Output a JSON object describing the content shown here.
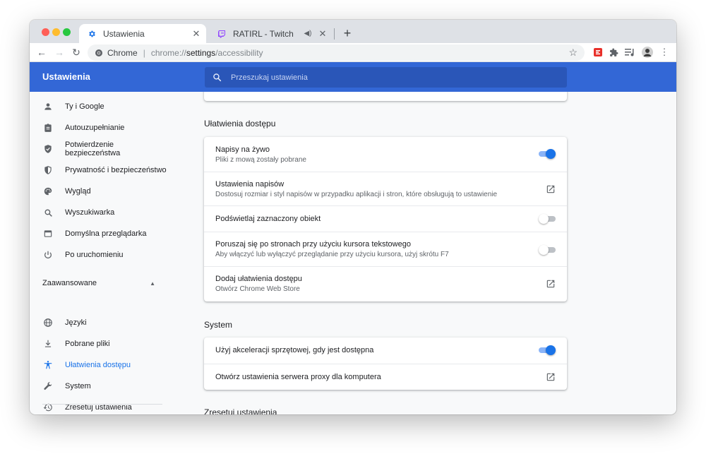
{
  "browser": {
    "tabs": [
      {
        "title": "Ustawienia",
        "icon": "gear-icon",
        "active": true
      },
      {
        "title": "RATIRL - Twitch",
        "icon": "twitch-icon",
        "active": false,
        "audio": true
      }
    ],
    "new_tab_label": "+",
    "omnibox": {
      "site_label": "Chrome",
      "divider": "|",
      "scheme": "chrome://",
      "host": "settings",
      "path": "/accessibility"
    }
  },
  "settings": {
    "title": "Ustawienia",
    "search_placeholder": "Przeszukaj ustawienia",
    "sidebar": {
      "items": [
        {
          "label": "Ty i Google",
          "icon": "person-icon"
        },
        {
          "label": "Autouzupełnianie",
          "icon": "clipboard-icon"
        },
        {
          "label": "Potwierdzenie bezpieczeństwa",
          "icon": "shield-check-icon"
        },
        {
          "label": "Prywatność i bezpieczeństwo",
          "icon": "shield-icon"
        },
        {
          "label": "Wygląd",
          "icon": "palette-icon"
        },
        {
          "label": "Wyszukiwarka",
          "icon": "search-icon"
        },
        {
          "label": "Domyślna przeglądarka",
          "icon": "browser-icon"
        },
        {
          "label": "Po uruchomieniu",
          "icon": "power-icon"
        }
      ],
      "advanced_label": "Zaawansowane",
      "advanced_items": [
        {
          "label": "Języki",
          "icon": "globe-icon"
        },
        {
          "label": "Pobrane pliki",
          "icon": "download-icon"
        },
        {
          "label": "Ułatwienia dostępu",
          "icon": "accessibility-icon",
          "selected": true
        },
        {
          "label": "System",
          "icon": "wrench-icon"
        },
        {
          "label": "Zresetuj ustawienia",
          "icon": "restore-icon"
        }
      ]
    },
    "accessibility": {
      "title": "Ułatwienia dostępu",
      "rows": [
        {
          "label": "Napisy na żywo",
          "sublabel": "Pliki z mową zostały pobrane",
          "control": "toggle",
          "on": true
        },
        {
          "label": "Ustawienia napisów",
          "sublabel": "Dostosuj rozmiar i styl napisów w przypadku aplikacji i stron, które obsługują to ustawienie",
          "control": "link"
        },
        {
          "label": "Podświetlaj zaznaczony obiekt",
          "control": "toggle",
          "on": false
        },
        {
          "label": "Poruszaj się po stronach przy użyciu kursora tekstowego",
          "sublabel": "Aby włączyć lub wyłączyć przeglądanie przy użyciu kursora, użyj skrótu F7",
          "control": "toggle",
          "on": false
        },
        {
          "label": "Dodaj ułatwienia dostępu",
          "sublabel": "Otwórz Chrome Web Store",
          "control": "link"
        }
      ]
    },
    "system": {
      "title": "System",
      "rows": [
        {
          "label": "Użyj akceleracji sprzętowej, gdy jest dostępna",
          "control": "toggle",
          "on": true
        },
        {
          "label": "Otwórz ustawienia serwera proxy dla komputera",
          "control": "link"
        }
      ]
    },
    "reset_title": "Zresetuj ustawienia"
  },
  "colors": {
    "header_blue": "#3367d6",
    "accent_blue": "#1a73e8",
    "toggle_track_on": "#8ab4f8"
  }
}
